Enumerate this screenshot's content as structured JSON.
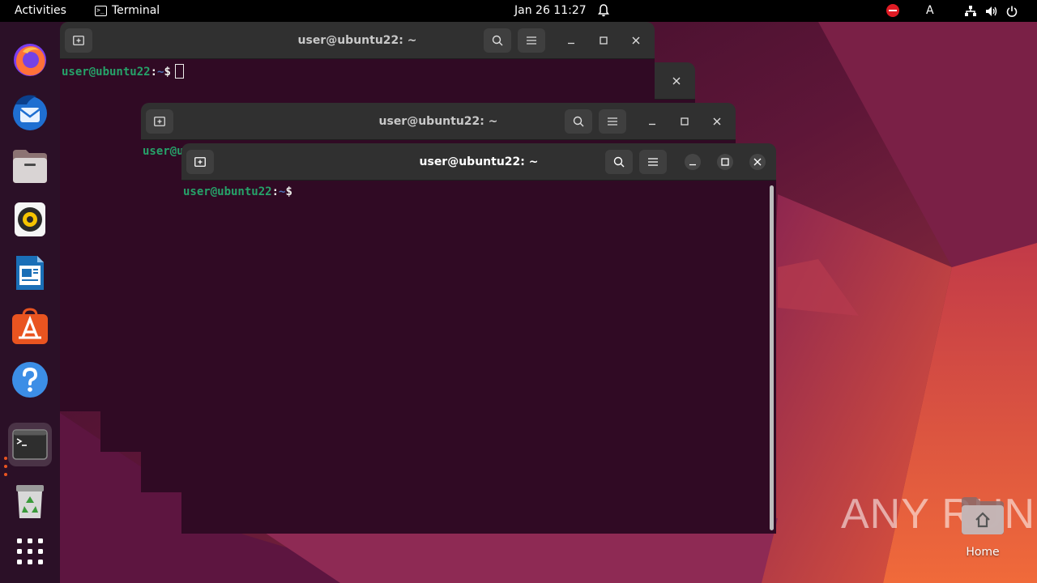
{
  "topbar": {
    "activities": "Activities",
    "app_name": "Terminal",
    "app_glyph": ">_",
    "clock": "Jan 26  11:27",
    "input_source": "A"
  },
  "dock": {
    "items": [
      {
        "name": "Firefox",
        "icon": "firefox-icon"
      },
      {
        "name": "Thunderbird",
        "icon": "thunderbird-icon"
      },
      {
        "name": "Files",
        "icon": "files-icon"
      },
      {
        "name": "Rhythmbox",
        "icon": "rhythmbox-icon"
      },
      {
        "name": "LibreOffice Writer",
        "icon": "writer-icon"
      },
      {
        "name": "Ubuntu Software",
        "icon": "software-icon"
      },
      {
        "name": "Help",
        "icon": "help-icon"
      },
      {
        "name": "Terminal",
        "icon": "terminal-icon",
        "running": true,
        "glyph": ">_"
      },
      {
        "name": "Trash",
        "icon": "trash-icon"
      },
      {
        "name": "Show Applications",
        "icon": "app-grid-icon"
      }
    ]
  },
  "windows": [
    {
      "title": "user@ubuntu22: ~",
      "state": "inactive",
      "prompt": {
        "user": "user@ubuntu22",
        "sep": ":",
        "dir": "~",
        "dollar": "$"
      }
    },
    {
      "title": "user@ubuntu22: ~",
      "state": "inactive",
      "prompt": {
        "user": "user@ubuntu22",
        "sep": ":",
        "dir": "~",
        "dollar": "$"
      }
    },
    {
      "title": "user@ubuntu22: ~",
      "state": "active",
      "prompt": {
        "user": "user@ubuntu22",
        "sep": ":",
        "dir": "~",
        "dollar": "$"
      }
    }
  ],
  "desktop": {
    "home_label": "Home"
  },
  "watermark": "ANY RUN",
  "colors": {
    "topbar": "#000000",
    "dock": "#2b1027",
    "terminal_bg": "#300a24",
    "titlebar": "#303030",
    "prompt_user": "#26a269",
    "prompt_dir": "#4e72b8",
    "accent": "#e95420"
  }
}
